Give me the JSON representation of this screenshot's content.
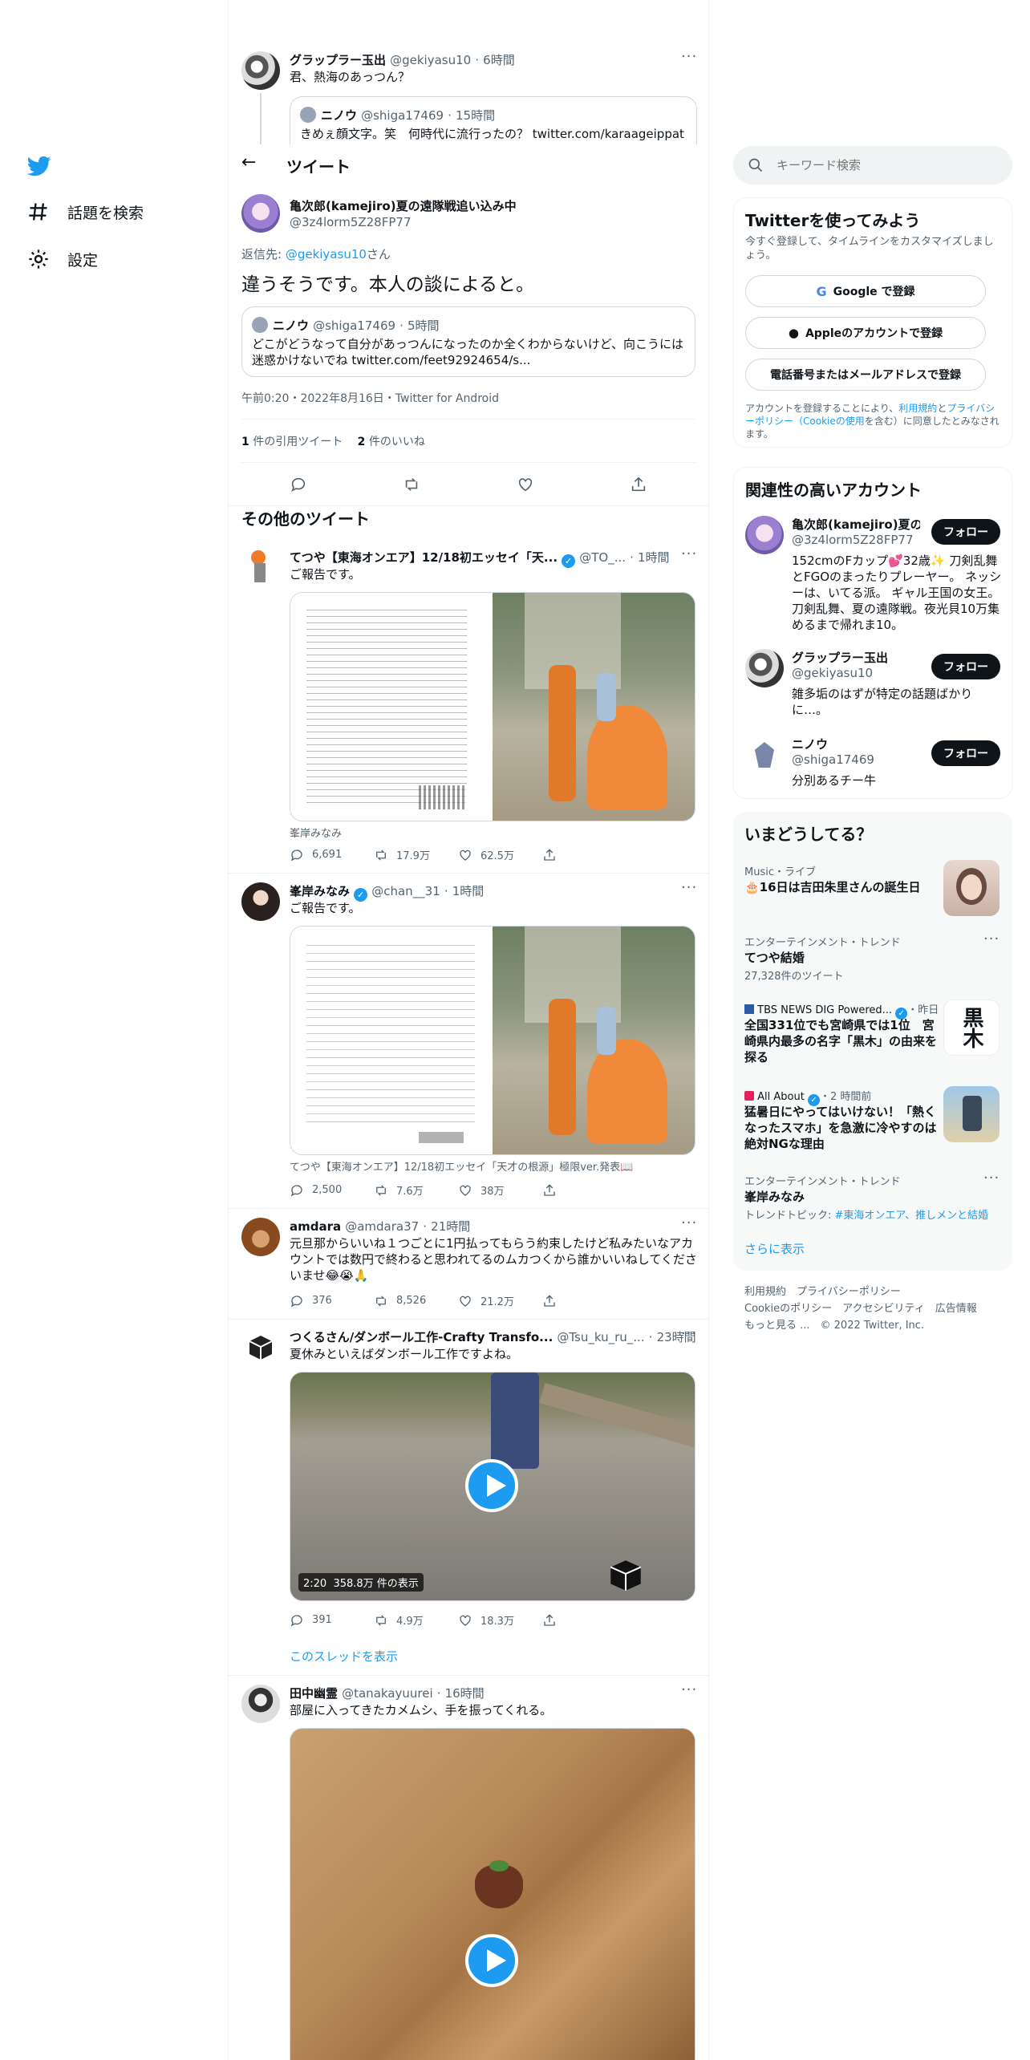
{
  "nav": {
    "explore": "話題を検索",
    "settings": "設定"
  },
  "header": {
    "title": "ツイート",
    "back": "←"
  },
  "context_tweet": {
    "name": "グラップラー玉出",
    "handle": "@gekiyasu10",
    "time": "6時間",
    "text": "君、熱海のあっつん？",
    "quote": {
      "name": "ニノウ",
      "handle": "@shiga17469",
      "time": "15時間",
      "text": "きめぇ顔文字。笑　何時代に流行ったの？ twitter.com/karaageippatu/..."
    }
  },
  "main_tweet": {
    "name": "亀次郎(kamejiro)夏の遠隊戦追い込み中",
    "handle": "@3z4lorm5Z28FP77",
    "reply_prefix": "返信先: ",
    "reply_to": "@gekiyasu10",
    "reply_suffix": "さん",
    "text": "違うそうです。本人の談によると。",
    "quote": {
      "name": "ニノウ",
      "handle": "@shiga17469",
      "time": "5時間",
      "text": "どこがどうなって自分があっつんになったのか全くわからないけど、向こうには迷惑かけないでね twitter.com/feet92924654/s..."
    },
    "timestamp": "午前0:20・2022年8月16日・Twitter for Android",
    "quote_count": "1",
    "quote_label": " 件の引用ツイート",
    "like_count": "2",
    "like_label": " 件のいいね"
  },
  "more_tweets_title": "その他のツイート",
  "tweets": [
    {
      "name": "てつや【東海オンエア】12/18初エッセイ「天...",
      "handle": "@TO_...",
      "time": "1時間",
      "text": "ご報告です。",
      "caption": "峯岸みなみ",
      "replies": "6,691",
      "retweets": "17.9万",
      "likes": "62.5万"
    },
    {
      "name": "峯岸みなみ",
      "handle": "@chan__31",
      "time": "1時間",
      "text": "ご報告です。",
      "caption": "てつや【東海オンエア】12/18初エッセイ「天才の根源」極限ver.発表📖",
      "replies": "2,500",
      "retweets": "7.6万",
      "likes": "38万"
    },
    {
      "name": "amdara",
      "handle": "@amdara37",
      "time": "21時間",
      "text": "元旦那からいいね１つごとに1円払ってもらう約束したけど私みたいなアカウントでは数円で終わると思われてるのムカつくから誰かいいねしてくださいませ😂😭🙏",
      "replies": "376",
      "retweets": "8,526",
      "likes": "21.2万"
    },
    {
      "name": "つくるさん/ダンボール工作-Crafty Transfo...",
      "handle": "@Tsu_ku_ru_...",
      "time": "23時間",
      "text": "夏休みといえばダンボール工作ですよね。",
      "video_badge": "2:20  358.8万 件の表示",
      "replies": "391",
      "retweets": "4.9万",
      "likes": "18.3万",
      "thread_link": "このスレッドを表示"
    },
    {
      "name": "田中幽霊",
      "handle": "@tanakayuurei",
      "time": "16時間",
      "text": "部屋に入ってきたカメムシ、手を振ってくれる。"
    }
  ],
  "search": {
    "placeholder": "キーワード検索"
  },
  "signup": {
    "title": "Twitterを使ってみよう",
    "subtitle": "今すぐ登録して、タイムラインをカスタマイズしましょう。",
    "google": "Google で登録",
    "apple": "Appleのアカウントで登録",
    "phone": "電話番号またはメールアドレスで登録",
    "terms_1": "アカウントを登録することにより、",
    "terms_link1": "利用規約",
    "terms_2": "と",
    "terms_link2": "プライバシーポリシー（Cookieの使用",
    "terms_3": "を含む）に同意したとみなされます。"
  },
  "related": {
    "title": "関連性の高いアカウント",
    "follow": "フォロー",
    "accounts": [
      {
        "name": "亀次郎(kamejiro)夏の...",
        "handle": "@3z4lorm5Z28FP77",
        "bio": "152cmのFカップ💕32歳✨ 刀剣乱舞とFGOのまったりプレーヤー。 ネッシーは、いてる派。 ギャル王国の女王。 刀剣乱舞、夏の遠隊戦。夜光貝10万集めるまで帰れま10。"
      },
      {
        "name": "グラップラー玉出",
        "handle": "@gekiyasu10",
        "bio": "雑多垢のはずが特定の話題ばかりに…。"
      },
      {
        "name": "ニノウ",
        "handle": "@shiga17469",
        "bio": "分別あるチー牛"
      }
    ]
  },
  "trends": {
    "title": "いまどうしてる？",
    "items": [
      {
        "meta": "Music・ライブ",
        "title": "🎂16日は吉田朱里さんの誕生日"
      },
      {
        "meta": "エンターテインメント・トレンド",
        "title": "てつや結婚",
        "sub": "27,328件のツイート"
      },
      {
        "source": "TBS NEWS DIG Powered...",
        "time": "・昨日",
        "title": "全国331位でも宮崎県では1位　宮崎県内最多の名字「黒木」の由来を探る",
        "thumb_text": "黒木"
      },
      {
        "source": "All About",
        "time": "・2 時間前",
        "title": "猛暑日にやってはいけない！「熱くなったスマホ」を急激に冷やすのは絶対NGな理由"
      },
      {
        "meta": "エンターテインメント・トレンド",
        "title": "峯岸みなみ",
        "sub_prefix": "トレンドトピック: ",
        "sub_link": "#東海オンエア、推しメンと結婚"
      }
    ],
    "show_more": "さらに表示"
  },
  "footer": {
    "line1": "利用規約　プライバシーポリシー",
    "line2": "Cookieのポリシー　アクセシビリティ　広告情報",
    "line3": "もっと見る ...　© 2022 Twitter, Inc."
  },
  "colors": {
    "accent": "#1d9bf0",
    "text": "#0f1419",
    "muted": "#536471"
  }
}
